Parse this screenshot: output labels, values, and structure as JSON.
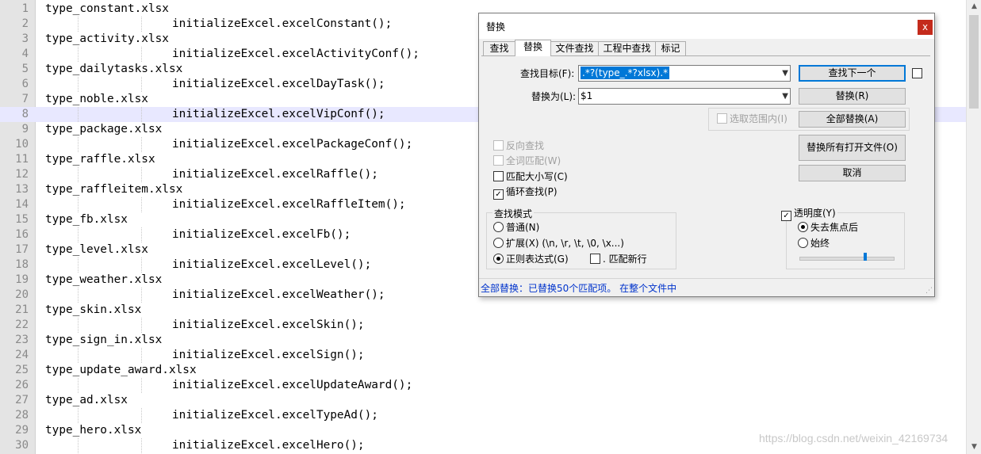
{
  "editor": {
    "lines": [
      {
        "n": "1",
        "text": "type_constant.xlsx"
      },
      {
        "n": "2",
        "text": "initializeExcel.excelConstant();"
      },
      {
        "n": "3",
        "text": "type_activity.xlsx"
      },
      {
        "n": "4",
        "text": "initializeExcel.excelActivityConf();"
      },
      {
        "n": "5",
        "text": "type_dailytasks.xlsx"
      },
      {
        "n": "6",
        "text": "initializeExcel.excelDayTask();"
      },
      {
        "n": "7",
        "text": "type_noble.xlsx"
      },
      {
        "n": "8",
        "text": "initializeExcel.excelVipConf();"
      },
      {
        "n": "9",
        "text": "type_package.xlsx"
      },
      {
        "n": "10",
        "text": "initializeExcel.excelPackageConf();"
      },
      {
        "n": "11",
        "text": "type_raffle.xlsx"
      },
      {
        "n": "12",
        "text": "initializeExcel.excelRaffle();"
      },
      {
        "n": "13",
        "text": "type_raffleitem.xlsx"
      },
      {
        "n": "14",
        "text": "initializeExcel.excelRaffleItem();"
      },
      {
        "n": "15",
        "text": "type_fb.xlsx"
      },
      {
        "n": "16",
        "text": "initializeExcel.excelFb();"
      },
      {
        "n": "17",
        "text": "type_level.xlsx"
      },
      {
        "n": "18",
        "text": "initializeExcel.excelLevel();"
      },
      {
        "n": "19",
        "text": "type_weather.xlsx"
      },
      {
        "n": "20",
        "text": "initializeExcel.excelWeather();"
      },
      {
        "n": "21",
        "text": "type_skin.xlsx"
      },
      {
        "n": "22",
        "text": "initializeExcel.excelSkin();"
      },
      {
        "n": "23",
        "text": "type_sign_in.xlsx"
      },
      {
        "n": "24",
        "text": "initializeExcel.excelSign();"
      },
      {
        "n": "25",
        "text": "type_update_award.xlsx"
      },
      {
        "n": "26",
        "text": "initializeExcel.excelUpdateAward();"
      },
      {
        "n": "27",
        "text": "type_ad.xlsx"
      },
      {
        "n": "28",
        "text": "initializeExcel.excelTypeAd();"
      },
      {
        "n": "29",
        "text": "type_hero.xlsx"
      },
      {
        "n": "30",
        "text": "initializeExcel.excelHero();"
      }
    ],
    "current_line": 8
  },
  "watermark": "https://blog.csdn.net/weixin_42169734",
  "dialog": {
    "title": "替换",
    "close": "x",
    "tabs": [
      "查找",
      "替换",
      "文件查找",
      "工程中查找",
      "标记"
    ],
    "active_tab": 1,
    "find_label": "查找目标(F):",
    "find_value": ".*?(type_.*?xlsx).*",
    "replace_label": "替换为(L):",
    "replace_value": "$1",
    "in_selection": "选取范围内(I)",
    "buttons": {
      "find_next": "查找下一个",
      "replace": "替换(R)",
      "replace_all": "全部替换(A)",
      "replace_all_open": "替换所有打开文件(O)",
      "cancel": "取消"
    },
    "options": {
      "backward": "反向查找",
      "whole_word": "全词匹配(W)",
      "match_case": "匹配大小写(C)",
      "wrap": "循环查找(P)"
    },
    "search_mode": {
      "title": "查找模式",
      "normal": "普通(N)",
      "extended": "扩展(X) (\\n, \\r, \\t, \\0, \\x...)",
      "regex": "正则表达式(G)",
      "dot_newline": ". 匹配新行"
    },
    "transparency": {
      "title": "透明度(Y)",
      "on_lose_focus": "失去焦点后",
      "always": "始终"
    },
    "status": "全部替换：已替换50个匹配项。 在整个文件中"
  },
  "colors": {
    "current_line": "#e8e8ff",
    "status_text": "#0033cc",
    "selection": "#0078d7",
    "close_button": "#c42b1c"
  }
}
